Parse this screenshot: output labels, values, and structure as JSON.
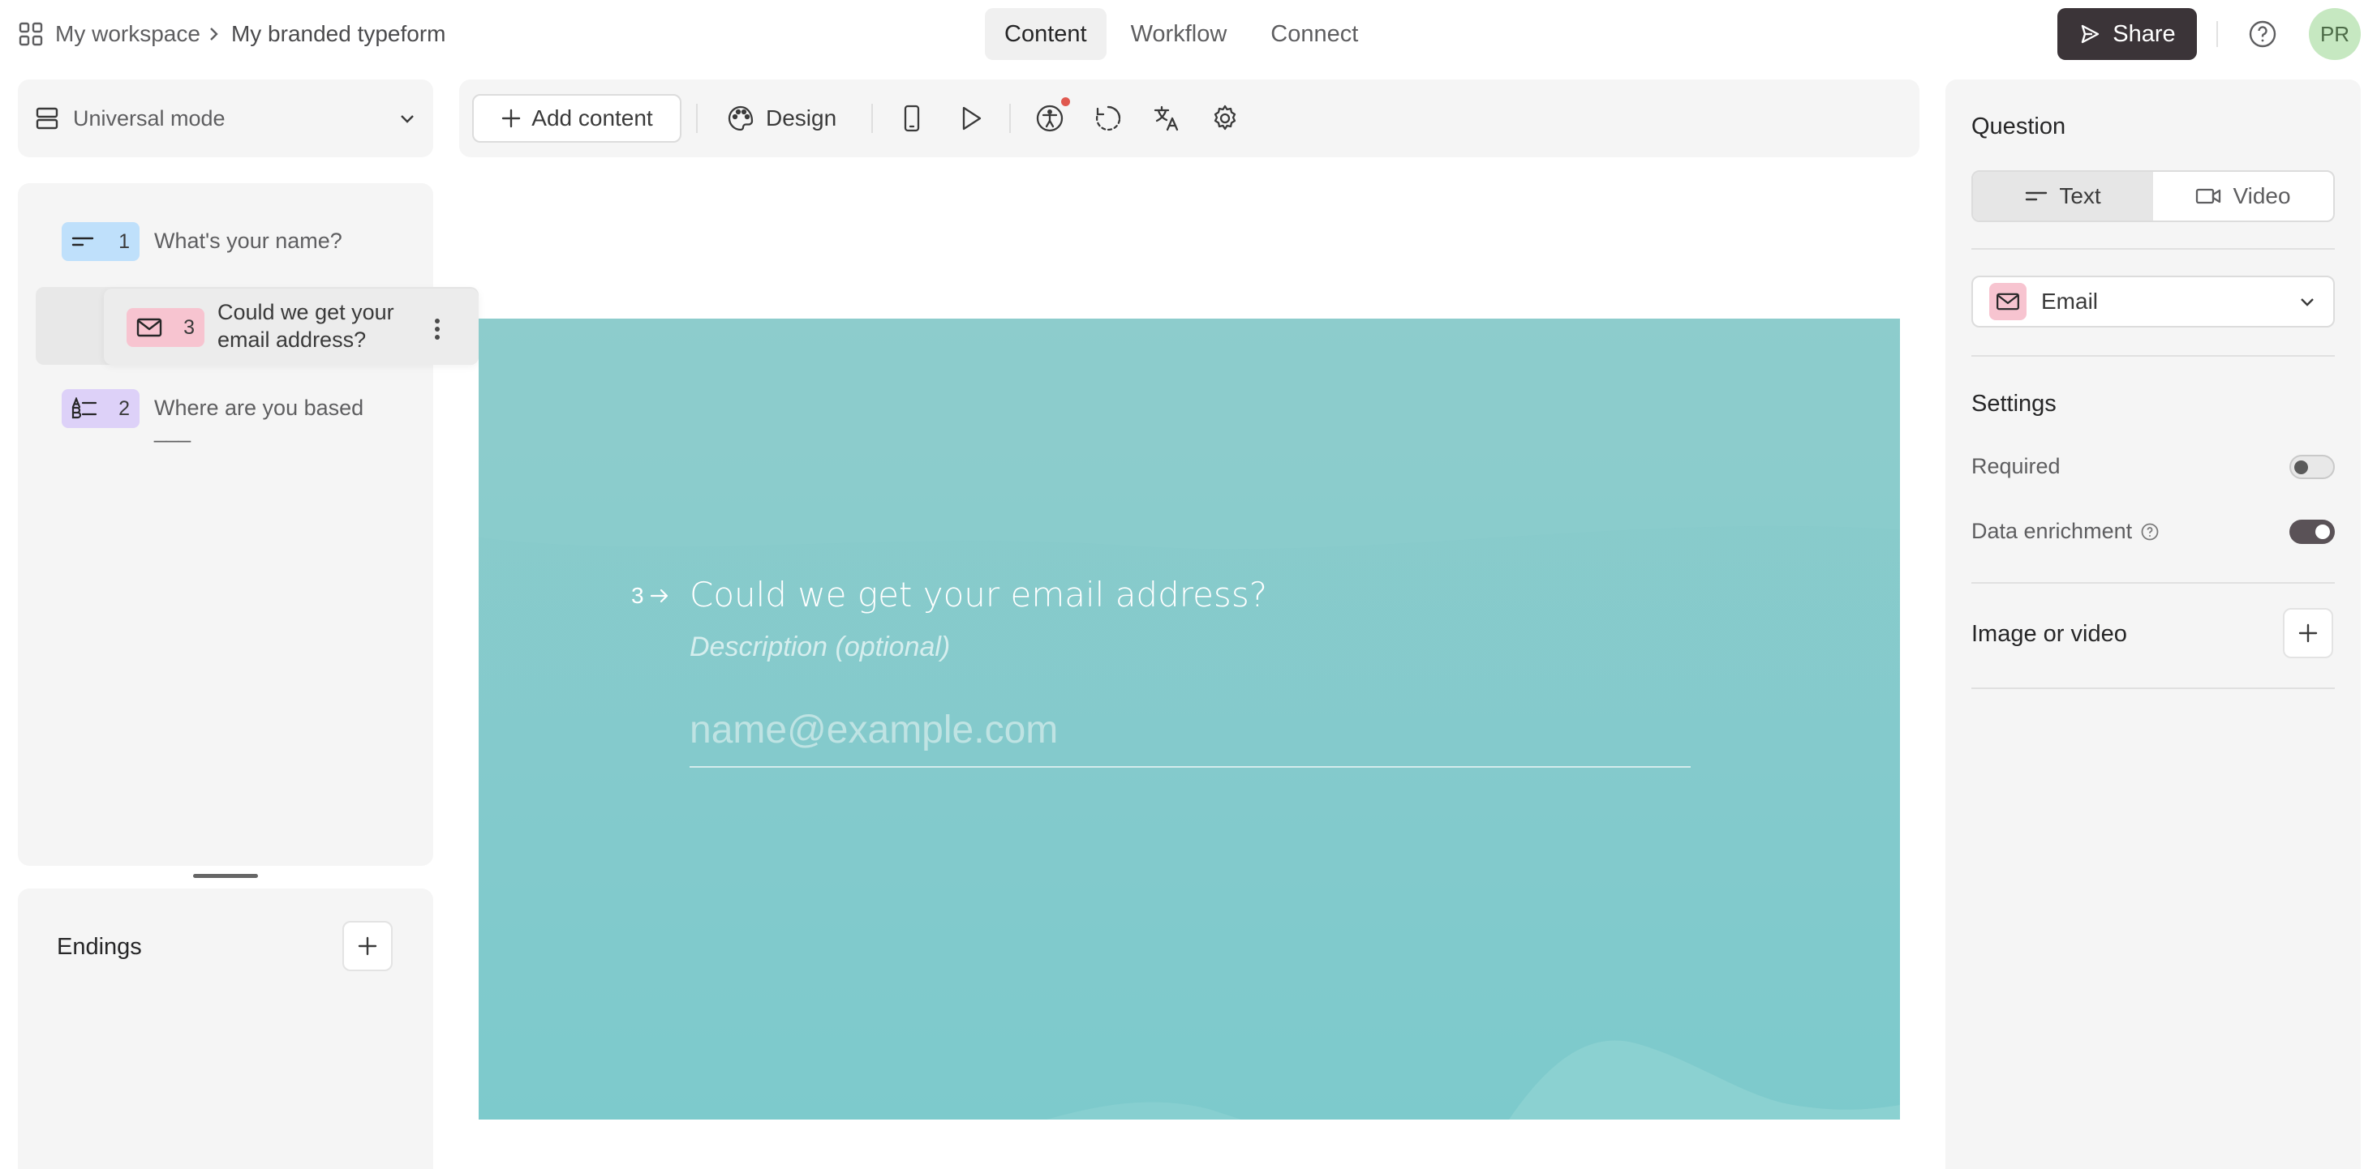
{
  "header": {
    "workspace": "My workspace",
    "form_title": "My branded typeform",
    "tabs": [
      {
        "label": "Content",
        "active": true
      },
      {
        "label": "Workflow",
        "active": false
      },
      {
        "label": "Connect",
        "active": false
      }
    ],
    "share_label": "Share",
    "avatar_initials": "PR"
  },
  "sidebar": {
    "mode_label": "Universal mode",
    "questions": [
      {
        "number": "1",
        "text": "What's your name?",
        "type": "short-text",
        "color": "#bfe0fb"
      },
      {
        "number": "3",
        "text": "Could we get your email address?",
        "type": "email",
        "color": "#f7c4d0"
      },
      {
        "number": "2",
        "text": "Where are you based",
        "extra": "___",
        "type": "multiple-choice",
        "color": "#ddd1f8"
      }
    ],
    "endings_label": "Endings"
  },
  "toolbar": {
    "add_content_label": "Add content",
    "design_label": "Design"
  },
  "canvas": {
    "background": "#7dcacc",
    "question_number": "3",
    "question_title": "Could we get your email address?",
    "description_placeholder": "Description (optional)",
    "input_placeholder": "name@example.com"
  },
  "right_panel": {
    "question_heading": "Question",
    "segment_options": [
      {
        "label": "Text",
        "active": true
      },
      {
        "label": "Video",
        "active": false
      }
    ],
    "question_type": "Email",
    "settings_heading": "Settings",
    "settings": [
      {
        "label": "Required",
        "enabled": false
      },
      {
        "label": "Data enrichment",
        "enabled": true
      }
    ],
    "media_label": "Image or video"
  }
}
